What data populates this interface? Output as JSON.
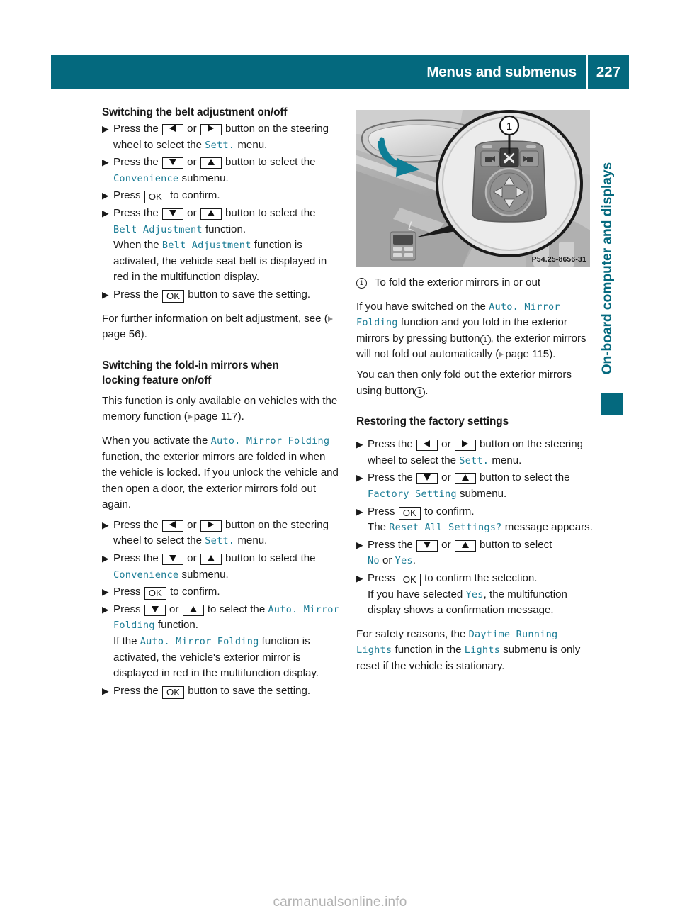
{
  "header": {
    "title": "Menus and submenus",
    "page_number": "227",
    "bar_color": "#04697e"
  },
  "side_tab": {
    "label": "On-board computer and displays",
    "color": "#04697e"
  },
  "figure": {
    "caption": "P54.25-8656-31",
    "callout_number": "1",
    "alt_name": "exterior-mirror-fold-control"
  },
  "ui_labels": {
    "ok": "OK",
    "or": "or"
  },
  "left_column": {
    "section1": {
      "heading": "Switching the belt adjustment on/off",
      "step1_a": "Press the",
      "step1_b": "button on the",
      "step1_c": "steering wheel to select the",
      "step1_menu": "Sett.",
      "step1_d": "menu.",
      "step2_a": "Press the",
      "step2_b": "button to select the",
      "step2_menu": "Convenience",
      "step2_c": "submenu.",
      "step3_a": "Press",
      "step3_b": "to confirm.",
      "step4_a": "Press the",
      "step4_b": "button to select the",
      "step4_menu": "Belt Adjustment",
      "step4_c": "function.",
      "step4_note_a": "When the",
      "step4_note_menu": "Belt Adjustment",
      "step4_note_b": "function is activated, the vehicle seat belt is displayed in red in the multifunction display.",
      "step5_a": "Press the",
      "step5_b": "button to save the setting.",
      "closing_a": "For further information on belt adjustment, see (",
      "closing_page": "page 56",
      "closing_b": ")."
    },
    "section2": {
      "heading_line1": "Switching the fold-in mirrors when",
      "heading_line2": "locking feature on/off",
      "intro_a": "This function is only available on vehicles with the memory function (",
      "intro_page": "page 117",
      "intro_b": ").",
      "para2_a": "When you activate the",
      "para2_menu": "Auto. Mirror Folding",
      "para2_b": "function, the exterior mirrors are folded in when the vehicle is locked. If you unlock the vehicle and then open a door, the exterior mirrors fold out again.",
      "step1_a": "Press the",
      "step1_b": "button on the",
      "step1_c": "steering wheel to select the",
      "step1_menu": "Sett.",
      "step1_d": "menu.",
      "step2_a": "Press the",
      "step2_b": "button to select the",
      "step2_menu": "Convenience",
      "step2_c": "submenu.",
      "step3_a": "Press",
      "step3_b": "to confirm.",
      "step4_a": "Press",
      "step4_b": "to select the",
      "step4_menu": "Auto. Mirror Folding",
      "step4_c": "function.",
      "step4_note_a": "If the",
      "step4_note_menu": "Auto. Mirror Folding",
      "step4_note_b": "function is activated, the vehicle's exterior mirror is displayed in red in the multifunction display.",
      "step5_a": "Press the",
      "step5_b": "button to save the setting."
    }
  },
  "right_column": {
    "figure_callout": "To fold the exterior mirrors in or out",
    "para1_a": "If you have switched on the",
    "para1_menu": "Auto. Mirror Folding",
    "para1_b": "function and you fold in the exterior mirrors by pressing button",
    "para1_c": ", the exterior mirrors will not fold out automatically (",
    "para1_page": "page 115",
    "para1_d": ").",
    "para2_a": "You can then only fold out the exterior mirrors using button",
    "para2_b": ".",
    "section": {
      "heading": "Restoring the factory settings",
      "step1_a": "Press the",
      "step1_b": "button on the",
      "step1_c": "steering wheel to select the",
      "step1_menu": "Sett.",
      "step1_d": "menu.",
      "step2_a": "Press the",
      "step2_b": "button to select the",
      "step2_menu": "Factory Setting",
      "step2_c": "submenu.",
      "step3_a": "Press",
      "step3_b": "to confirm.",
      "step3_note_a": "The",
      "step3_note_menu": "Reset All Settings?",
      "step3_note_b": "message appears.",
      "step4_a": "Press the",
      "step4_b": "button to select",
      "step4_no": "No",
      "step4_or": "or",
      "step4_yes": "Yes",
      "step4_c": ".",
      "step5_a": "Press",
      "step5_b": "to confirm the selection.",
      "step5_note_a": "If you have selected",
      "step5_note_yes": "Yes",
      "step5_note_b": ", the multifunction display shows a confirmation message.",
      "closing_a": "For safety reasons, the",
      "closing_menu1": "Daytime Running Lights",
      "closing_b": "function in the",
      "closing_menu2": "Lights",
      "closing_c": "submenu is only reset if the vehicle is stationary."
    }
  },
  "footer": {
    "watermark": "carmanualsonline.info"
  }
}
